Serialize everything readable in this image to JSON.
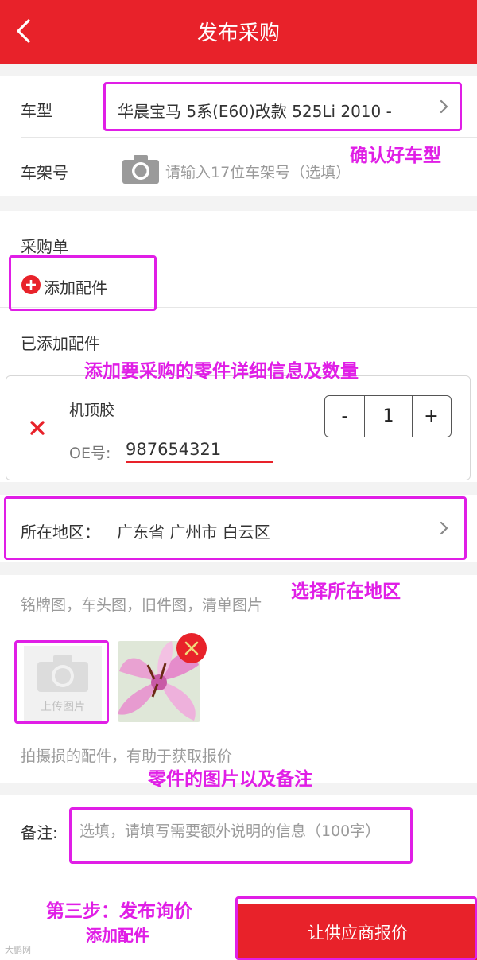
{
  "header": {
    "title": "发布采购"
  },
  "vehicle": {
    "model_label": "车型",
    "model_value": "华晨宝马 5系(E60)改款 525Li 2010 -",
    "vin_label": "车架号",
    "vin_placeholder": "请输入17位车架号（选填）"
  },
  "purchase": {
    "section_title": "采购单",
    "add_part_label": "添加配件",
    "added_title": "已添加配件",
    "part": {
      "name": "机顶胶",
      "oe_label": "OE号:",
      "oe_value": "987654321",
      "quantity": "1",
      "minus": "-",
      "plus": "+"
    }
  },
  "region": {
    "label": "所在地区：",
    "value": "广东省 广州市 白云区"
  },
  "photos": {
    "hint": "铭牌图，车头图，旧件图，清单图片",
    "upload_label": "上传图片",
    "footer_hint": "拍摄损的配件，有助于获取报价"
  },
  "remark": {
    "label": "备注:",
    "placeholder": "选填，请填写需要额外说明的信息（100字）"
  },
  "bottom": {
    "submit_label": "让供应商报价",
    "add_part_label": "添加配件"
  },
  "annotations": {
    "confirm_model": "确认好车型",
    "add_part_detail": "添加要采购的零件详细信息及数量",
    "choose_region": "选择所在地区",
    "photo_remark": "零件的图片以及备注",
    "step_three": "第三步：发布询价"
  },
  "watermark": "大鹏网",
  "colors": {
    "brand_red": "#e8222a",
    "annotation_magenta": "#e01ee6",
    "divider": "#e6e6e6",
    "background_gray": "#f3f3f3"
  },
  "icons": {
    "back": "chevron-left-icon",
    "model_chevron": "chevron-right-icon",
    "camera": "camera-icon",
    "add": "plus-circle-icon",
    "remove": "close-icon",
    "region_chevron": "chevron-right-icon",
    "delete_photo": "close-icon"
  }
}
